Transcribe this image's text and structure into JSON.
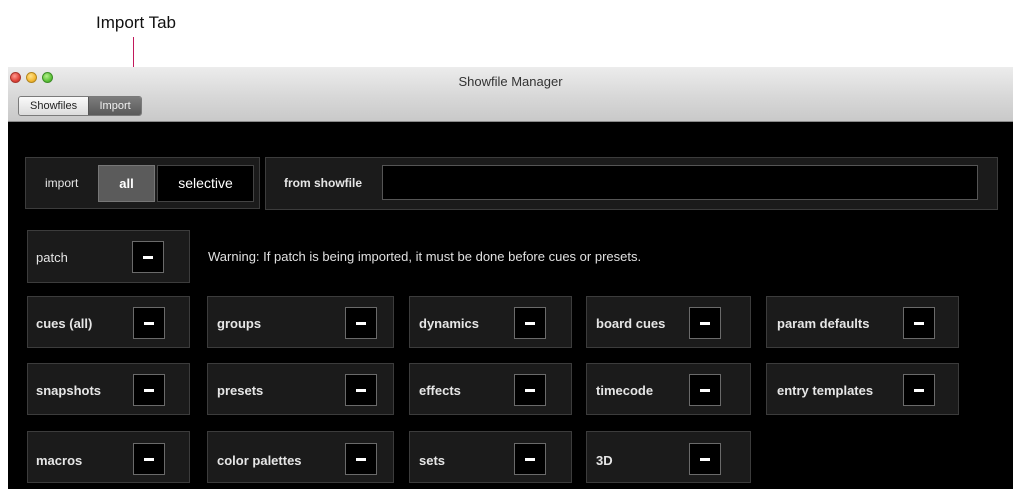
{
  "annotation": {
    "text": "Import Tab"
  },
  "window": {
    "title": "Showfile Manager"
  },
  "tabs": [
    {
      "label": "Showfiles"
    },
    {
      "label": "Import",
      "active": true
    }
  ],
  "import_row": {
    "import_label": "import",
    "modes": [
      {
        "label": "all",
        "selected": true
      },
      {
        "label": "selective",
        "selected": false
      }
    ],
    "from_label": "from showfile",
    "from_value": ""
  },
  "patch": {
    "label": "patch",
    "state": "–"
  },
  "warning": "Warning: If patch is being imported, it must be done before cues or presets.",
  "options": [
    {
      "label": "cues (all)",
      "state": "–"
    },
    {
      "label": "groups",
      "state": "–"
    },
    {
      "label": "dynamics",
      "state": "–"
    },
    {
      "label": "board cues",
      "state": "–"
    },
    {
      "label": "param defaults",
      "state": "–"
    },
    {
      "label": "snapshots",
      "state": "–"
    },
    {
      "label": "presets",
      "state": "–"
    },
    {
      "label": "effects",
      "state": "–"
    },
    {
      "label": "timecode",
      "state": "–"
    },
    {
      "label": "entry templates",
      "state": "–"
    },
    {
      "label": "macros",
      "state": "–"
    },
    {
      "label": "color palettes",
      "state": "–"
    },
    {
      "label": "sets",
      "state": "–"
    },
    {
      "label": "3D",
      "state": "–"
    }
  ],
  "colors": {
    "background": "#000000",
    "panel": "#1b1b1b",
    "annotation_line": "#c2185b"
  }
}
